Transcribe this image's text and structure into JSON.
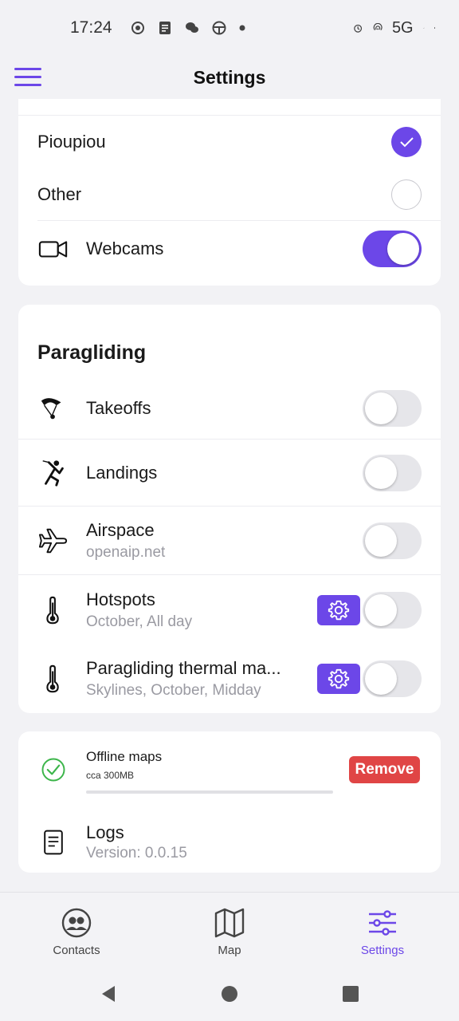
{
  "status": {
    "time": "17:24",
    "network": "5G"
  },
  "appbar": {
    "title": "Settings"
  },
  "sources": {
    "items": [
      {
        "label": "Pioupiou",
        "checked": true
      },
      {
        "label": "Other",
        "checked": false
      }
    ],
    "webcams": {
      "label": "Webcams",
      "enabled": true,
      "icon": "video-camera-icon"
    }
  },
  "paragliding": {
    "title": "Paragliding",
    "items": [
      {
        "label": "Takeoffs",
        "sub": "",
        "enabled": false,
        "icon": "paraglider-icon"
      },
      {
        "label": "Landings",
        "sub": "",
        "enabled": false,
        "icon": "landing-person-icon"
      },
      {
        "label": "Airspace",
        "sub": "openaip.net",
        "enabled": false,
        "icon": "airplane-icon"
      },
      {
        "label": "Hotspots",
        "sub": "October, All day",
        "enabled": false,
        "icon": "thermometer-icon"
      },
      {
        "label": "Paragliding thermal ma...",
        "sub": "Skylines, October, Midday",
        "enabled": false,
        "icon": "thermometer-icon"
      }
    ]
  },
  "offline": {
    "title": "Offline maps",
    "size": "cca 300MB",
    "remove_label": "Remove",
    "progress": 0
  },
  "logs": {
    "title": "Logs",
    "version": "Version: 0.0.15"
  },
  "nav": {
    "contacts": "Contacts",
    "map": "Map",
    "settings": "Settings"
  },
  "colors": {
    "accent": "#6c47e8",
    "danger": "#e04545",
    "success": "#3cb54a"
  }
}
